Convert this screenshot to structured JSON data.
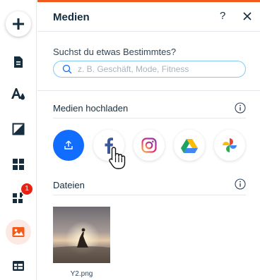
{
  "rail": {
    "badge_count": "1",
    "accent_color": "#f25a1d",
    "items": [
      "add-icon",
      "page-icon",
      "theme-icon",
      "background-icon",
      "apps-icon",
      "puzzle-icon",
      "media-icon",
      "table-icon"
    ]
  },
  "panel": {
    "title": "Medien",
    "help_label": "?",
    "search": {
      "label": "Suchst du etwas Bestimmtes?",
      "placeholder": "z. B. Geschäft, Mode, Fitness"
    },
    "upload_section": {
      "title": "Medien hochladen",
      "sources": [
        "upload-icon",
        "facebook-icon",
        "instagram-icon",
        "google-drive-icon",
        "google-photos-icon"
      ]
    },
    "files_section": {
      "title": "Dateien",
      "files": [
        {
          "name": "Y2.png"
        }
      ]
    }
  }
}
